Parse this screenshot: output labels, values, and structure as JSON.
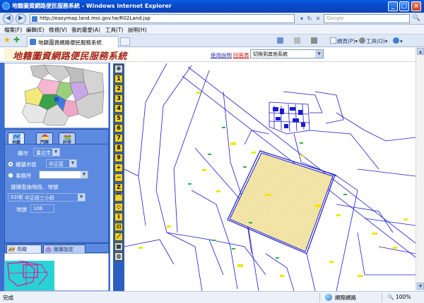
{
  "browser": {
    "window_title": "地籍圖資網路便民服務系統 - Windows Internet Explorer",
    "url": "http://easymap.land.moi.gov.tw/R02Land.jsp",
    "search_placeholder": "Google",
    "menu": [
      "檔案(F)",
      "編輯(E)",
      "檢視(V)",
      "我的最愛(A)",
      "工具(T)",
      "說明(H)"
    ],
    "tab_label": "地籍圖資網路便民服務系統",
    "commands": {
      "page": "網頁(P)",
      "tools": "工具(O)"
    },
    "minimize_glyph": "_",
    "maximize_glyph": "□",
    "close_glyph": "×",
    "back_glyph": "◀",
    "forward_glyph": "▶",
    "refresh_glyph": "↻",
    "stop_glyph": "✕",
    "search_go_glyph": "🔍",
    "star_glyph": "★",
    "add_fav_glyph": "✚",
    "scroll_up_glyph": "▲",
    "scroll_down_glyph": "▼"
  },
  "status": {
    "left_text": "完成",
    "zone_text": "網際網路",
    "zoom_text": "100%"
  },
  "site": {
    "title": "地籍圖資網路便民服務系統",
    "help_link": "使用說明",
    "home_link": "回首頁",
    "system_select_value": "切換到其他系統"
  },
  "panel": {
    "tabs": [
      "地籍",
      "門牌",
      "村里"
    ],
    "city_label": "縣市",
    "city_value": "臺北市",
    "district_label": "鄉鎮市區",
    "district_value": "中正區",
    "office_label": "事務所",
    "office_value": "",
    "section_label": "選擇查詢地段、地號",
    "section_code": "0208",
    "section_name": "中正段三小段",
    "lot_label": "地號",
    "lot_value": "106",
    "query_button": "查詢",
    "bottom_tabs": [
      "鳥瞰",
      "圖層設定"
    ]
  },
  "tools": [
    "1",
    "2",
    "3",
    "4",
    "5",
    "6",
    "7",
    "8",
    "9"
  ],
  "colors": {
    "title_red": "#a6231c",
    "panel_blue": "#3c6ed0",
    "map_line": "#1a1acc",
    "parcel_fill": "#f7edb4",
    "marker_yellow": "#f2e600"
  }
}
